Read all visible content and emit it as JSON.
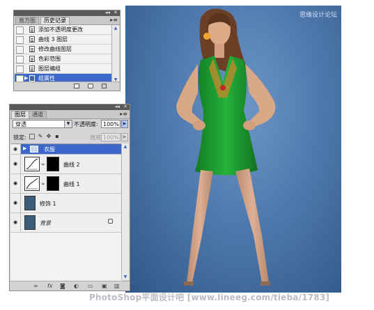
{
  "photo": {
    "watermark": "思缘设计论坛",
    "colors": {
      "background": "#4f79ad",
      "dress": "#1a9a2b",
      "skin": "#d9a887",
      "hair": "#6b3f25"
    }
  },
  "footer_caption": "PhotoShop平面设计吧 [www.lineeg.com/tieba/1783]",
  "history_panel": {
    "tabs": [
      {
        "label": "直方图",
        "active": false
      },
      {
        "label": "历史记录",
        "active": true
      }
    ],
    "items": [
      {
        "label": "添加不透明度更改",
        "selected": false
      },
      {
        "label": "曲线 3 图层",
        "selected": false
      },
      {
        "label": "修改曲线图层",
        "selected": false
      },
      {
        "label": "色彩范围",
        "selected": false
      },
      {
        "label": "图层编组",
        "selected": false
      },
      {
        "label": "组属性",
        "selected": true
      }
    ],
    "footer_icons": [
      "new-document-from-state-icon",
      "camera-snapshot-icon",
      "trash-icon"
    ]
  },
  "layers_panel": {
    "tabs": [
      {
        "label": "图层",
        "active": true
      },
      {
        "label": "通道",
        "active": false
      }
    ],
    "blend_mode": "穿透",
    "opacity_label": "不透明度:",
    "opacity_value": "100%",
    "lock_label": "锁定:",
    "fill_label": "填充:",
    "fill_value": "100%",
    "layers": [
      {
        "name": "衣服",
        "type": "group",
        "selected": true
      },
      {
        "name": "曲线 2",
        "type": "adjustment",
        "selected": false
      },
      {
        "name": "曲线 1",
        "type": "adjustment",
        "selected": false
      },
      {
        "name": "修饰 1",
        "type": "image",
        "selected": false
      },
      {
        "name": "背景",
        "type": "background",
        "selected": false
      }
    ],
    "footer_icons": [
      "link-layers-icon",
      "fx-icon",
      "add-mask-icon",
      "adjustment-layer-icon",
      "new-group-icon",
      "new-layer-icon",
      "trash-icon"
    ]
  }
}
